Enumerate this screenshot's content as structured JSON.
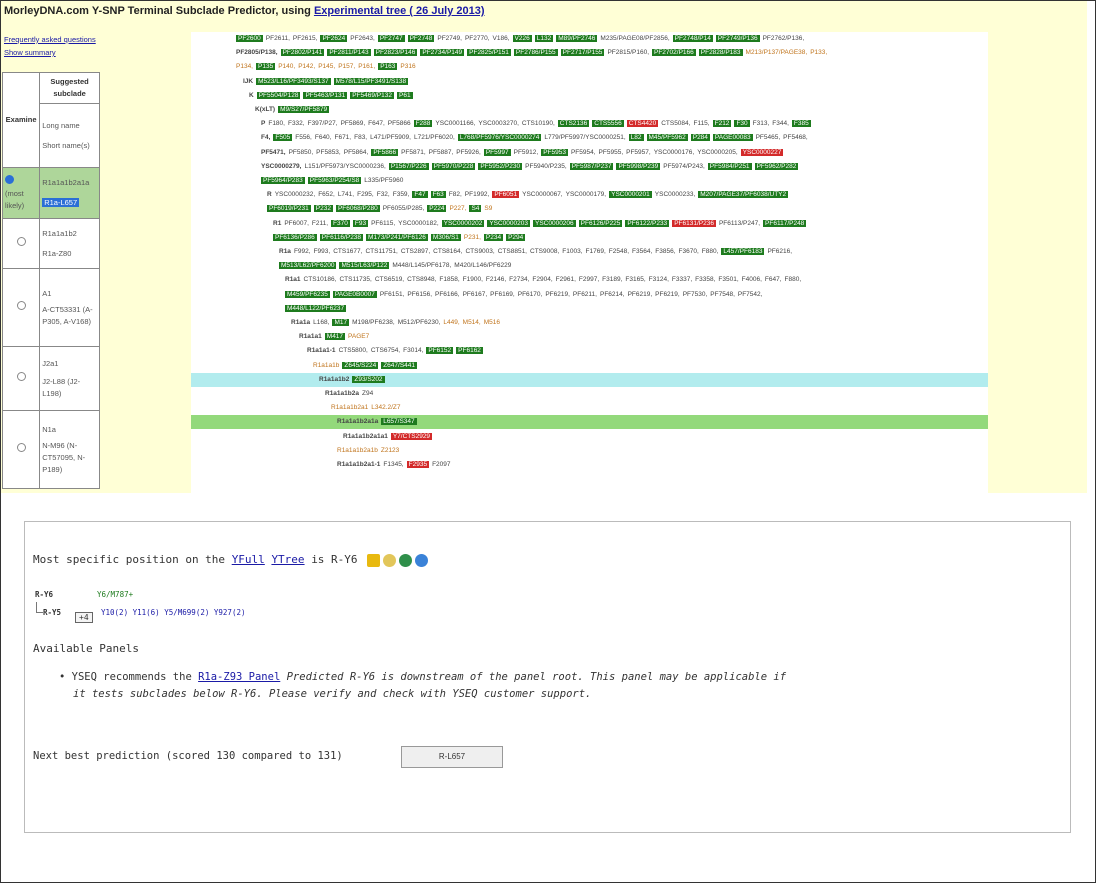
{
  "header": {
    "title": "MorleyDNA.com Y-SNP Terminal Subclade Predictor, using",
    "tree_link": "Experimental tree ( 26 July 2013)",
    "faq_link": "Frequently asked questions",
    "summary_link": "Show summary"
  },
  "sidebar": {
    "col_examine": "Examine",
    "col_suggested": "Suggested subclade",
    "col_names_long": "Long name",
    "col_names_short": "Short name(s)",
    "rows": [
      {
        "radio": "(most likely)",
        "long": "R1a1a1b2a1a",
        "short": "R1a-L657",
        "selected": true
      },
      {
        "radio": "",
        "long": "R1a1a1b2",
        "short": "R1a-Z80",
        "selected": false
      },
      {
        "radio": "",
        "long": "A1",
        "short": "A-CT53331 (A-P305, A-V168)",
        "selected": false
      },
      {
        "radio": "",
        "long": "J2a1",
        "short": "J2-L88 (J2-L198)",
        "selected": false
      },
      {
        "radio": "",
        "long": "N1a",
        "short": "N-M96 (N-CT57095, N-P189)",
        "selected": false
      }
    ]
  },
  "tree": [
    {
      "indent": 45,
      "items": [
        [
          "g",
          "PF2600"
        ],
        [
          "t",
          "PF2611,"
        ],
        [
          "t",
          "PF2615,"
        ],
        [
          "g",
          "PF2624"
        ],
        [
          "t",
          "PF2643,"
        ],
        [
          "g",
          "PF2747"
        ],
        [
          "g",
          "PF2748"
        ],
        [
          "t",
          "PF2749,"
        ],
        [
          "t",
          "PF2770,"
        ],
        [
          "t",
          "V186,"
        ],
        [
          "g",
          "V226"
        ],
        [
          "g",
          "L132"
        ],
        [
          "g",
          "M89/PF2746"
        ],
        [
          "t",
          "M235/PAGE08/PF2856,"
        ],
        [
          "g",
          "PF2748/P14"
        ],
        [
          "g",
          "PF2749/P136"
        ],
        [
          "t",
          "PF2762/P136,"
        ]
      ]
    },
    {
      "indent": 45,
      "items": [
        [
          "t",
          "PF2805/P138,"
        ],
        [
          "g",
          "PF2802/P141"
        ],
        [
          "g",
          "PF2811/P143"
        ],
        [
          "g",
          "PF2823/P146"
        ],
        [
          "g",
          "PF2734/P149"
        ],
        [
          "g",
          "PF2825/P151"
        ],
        [
          "g",
          "PF2786/P155"
        ],
        [
          "g",
          "PF2717/P155"
        ],
        [
          "t",
          "PF2815/P160,"
        ],
        [
          "g",
          "PF2702/P166"
        ],
        [
          "g",
          "PF2828/P183"
        ],
        [
          "o",
          "M213/P137/PAGE38,"
        ],
        [
          "o",
          "P133,"
        ]
      ]
    },
    {
      "indent": 45,
      "items": [
        [
          "o",
          "P134,"
        ],
        [
          "g",
          "P135"
        ],
        [
          "o",
          "P140,"
        ],
        [
          "o",
          "P142,"
        ],
        [
          "o",
          "P145,"
        ],
        [
          "o",
          "P157,"
        ],
        [
          "o",
          "P161,"
        ],
        [
          "g",
          "P163"
        ],
        [
          "o",
          "P316"
        ]
      ]
    },
    {
      "indent": 52,
      "items": [
        [
          "t",
          "IJK"
        ],
        [
          "g",
          "M523/L16/PF3493/S137"
        ],
        [
          "g",
          "M578/L15/PF3491/S138"
        ]
      ]
    },
    {
      "indent": 58,
      "items": [
        [
          "t",
          "K"
        ],
        [
          "g",
          "PF5504/P128"
        ],
        [
          "g",
          "PF5463/P131"
        ],
        [
          "g",
          "PF5469/P132"
        ],
        [
          "g",
          "P61"
        ]
      ]
    },
    {
      "indent": 64,
      "items": [
        [
          "t",
          "K(xLT)"
        ],
        [
          "g",
          "M9/S27/PF5879"
        ]
      ]
    },
    {
      "indent": 70,
      "items": [
        [
          "t",
          "P"
        ],
        [
          "t",
          "F180,"
        ],
        [
          "t",
          "F332,"
        ],
        [
          "t",
          "F397/P27,"
        ],
        [
          "t",
          "PF5869,"
        ],
        [
          "t",
          "F647,"
        ],
        [
          "t",
          "PF5866"
        ],
        [
          "g",
          "F288"
        ],
        [
          "t",
          "YSC0001166,"
        ],
        [
          "t",
          "YSC0003270,"
        ],
        [
          "t",
          "CTS10190,"
        ],
        [
          "g",
          "CTS2136"
        ],
        [
          "g",
          "CTS5556"
        ],
        [
          "r",
          "CTS4420"
        ],
        [
          "t",
          "CTS5084,"
        ],
        [
          "t",
          "F115,"
        ],
        [
          "g",
          "F212"
        ],
        [
          "g",
          "F30"
        ],
        [
          "t",
          "F313,"
        ],
        [
          "t",
          "F344,"
        ],
        [
          "g",
          "F385"
        ]
      ]
    },
    {
      "indent": 70,
      "items": [
        [
          "t",
          "F4,"
        ],
        [
          "g",
          "F505"
        ],
        [
          "t",
          "F556,"
        ],
        [
          "t",
          "F640,"
        ],
        [
          "t",
          "F671,"
        ],
        [
          "t",
          "F83,"
        ],
        [
          "t",
          "L471/PF5909,"
        ],
        [
          "t",
          "L721/PF6020,"
        ],
        [
          "g",
          "L768/PF5976/YSC0000274"
        ],
        [
          "t",
          "L779/PF5997/YSC0000251,"
        ],
        [
          "g",
          "L82"
        ],
        [
          "g",
          "M45/PF5962"
        ],
        [
          "g",
          "P284"
        ],
        [
          "g",
          "PAGE00083"
        ],
        [
          "t",
          "PF5465,"
        ],
        [
          "t",
          "PF5468,"
        ]
      ]
    },
    {
      "indent": 70,
      "items": [
        [
          "t",
          "PF5471,"
        ],
        [
          "t",
          "PF5850,"
        ],
        [
          "t",
          "PF5853,"
        ],
        [
          "t",
          "PF5864,"
        ],
        [
          "g",
          "PF5866"
        ],
        [
          "t",
          "PF5871,"
        ],
        [
          "t",
          "PF5887,"
        ],
        [
          "t",
          "PF5926,"
        ],
        [
          "g",
          "PF5997"
        ],
        [
          "t",
          "PF5912,"
        ],
        [
          "g",
          "PF5953"
        ],
        [
          "t",
          "PF5954,"
        ],
        [
          "t",
          "PF5955,"
        ],
        [
          "t",
          "PF5957,"
        ],
        [
          "t",
          "YSC0000176,"
        ],
        [
          "t",
          "YSC0000205,"
        ],
        [
          "r",
          "YSC0000227"
        ]
      ]
    },
    {
      "indent": 70,
      "items": [
        [
          "t",
          "YSC0000279,"
        ],
        [
          "t",
          "L151/PF5973/YSC0000236,"
        ],
        [
          "g",
          "P1567/P226"
        ],
        [
          "g",
          "PF5970/P228"
        ],
        [
          "g",
          "PF5952/P230"
        ],
        [
          "t",
          "PF5940/P235,"
        ],
        [
          "g",
          "PF5987/P237"
        ],
        [
          "g",
          "PF5998/P239"
        ],
        [
          "t",
          "PF5974/P243,"
        ],
        [
          "g",
          "PF5984/P251"
        ],
        [
          "g",
          "PF5962/P282"
        ]
      ]
    },
    {
      "indent": 70,
      "items": [
        [
          "g",
          "PF5964/P283"
        ],
        [
          "g",
          "PF5963/P254/S8"
        ],
        [
          "t",
          "L335/PF5960"
        ]
      ]
    },
    {
      "indent": 76,
      "items": [
        [
          "t",
          "R"
        ],
        [
          "t",
          "YSC0000232,"
        ],
        [
          "t",
          "F652,"
        ],
        [
          "t",
          "L741,"
        ],
        [
          "t",
          "F295,"
        ],
        [
          "t",
          "F32,"
        ],
        [
          "t",
          "F359,"
        ],
        [
          "g",
          "F47"
        ],
        [
          "g",
          "F63"
        ],
        [
          "t",
          "F82,"
        ],
        [
          "t",
          "PF1992,"
        ],
        [
          "r",
          "PF6051"
        ],
        [
          "t",
          "YSC0000067,"
        ],
        [
          "t",
          "YSC0000179,"
        ],
        [
          "g",
          "YSC0000201"
        ],
        [
          "t",
          "YSC0000233,"
        ],
        [
          "g",
          "M207/PAGE37/PF6038/UTY2"
        ]
      ]
    },
    {
      "indent": 76,
      "items": [
        [
          "g",
          "PF6019/P231"
        ],
        [
          "g",
          "P232"
        ],
        [
          "g",
          "PF6068/P280"
        ],
        [
          "t",
          "PF6055/P285,"
        ],
        [
          "g",
          "P224"
        ],
        [
          "o",
          "P227,"
        ],
        [
          "g",
          "S4"
        ],
        [
          "o",
          "S9"
        ]
      ]
    },
    {
      "indent": 82,
      "items": [
        [
          "t",
          "R1"
        ],
        [
          "t",
          "PF6007,"
        ],
        [
          "t",
          "F211,"
        ],
        [
          "g",
          "F370"
        ],
        [
          "g",
          "F93"
        ],
        [
          "t",
          "PF6115,"
        ],
        [
          "t",
          "YSC0000182,"
        ],
        [
          "g",
          "YSC0000202"
        ],
        [
          "g",
          "YSC0000203"
        ],
        [
          "g",
          "YSC0000206"
        ],
        [
          "g",
          "PF6126/P225"
        ],
        [
          "g",
          "PF6122/P233"
        ],
        [
          "r",
          "PF6131/P236"
        ],
        [
          "t",
          "PF6113/P247,"
        ],
        [
          "g",
          "PF6117/P248"
        ]
      ]
    },
    {
      "indent": 82,
      "items": [
        [
          "g",
          "PF6136/P286"
        ],
        [
          "g",
          "PF6116/P238"
        ],
        [
          "g",
          "M173/P241/PF6126"
        ],
        [
          "g",
          "M306/S1"
        ],
        [
          "o",
          "P231,"
        ],
        [
          "g",
          "P234"
        ],
        [
          "g",
          "P294"
        ]
      ]
    },
    {
      "indent": 88,
      "items": [
        [
          "t",
          "R1a"
        ],
        [
          "t",
          "F992,"
        ],
        [
          "t",
          "F993,"
        ],
        [
          "t",
          "CTS1677,"
        ],
        [
          "t",
          "CTS11751,"
        ],
        [
          "t",
          "CTS2897,"
        ],
        [
          "t",
          "CTS8164,"
        ],
        [
          "t",
          "CTS9003,"
        ],
        [
          "t",
          "CTS8851,"
        ],
        [
          "t",
          "CTS9008,"
        ],
        [
          "t",
          "F1003,"
        ],
        [
          "t",
          "F1769,"
        ],
        [
          "t",
          "F2548,"
        ],
        [
          "t",
          "F3564,"
        ],
        [
          "t",
          "F3856,"
        ],
        [
          "t",
          "F3670,"
        ],
        [
          "t",
          "F880,"
        ],
        [
          "g",
          "L457/PF6183"
        ],
        [
          "t",
          "PF6216,"
        ]
      ]
    },
    {
      "indent": 88,
      "items": [
        [
          "g",
          "M513/L62/PF6200"
        ],
        [
          "g",
          "M515/L63/P122"
        ],
        [
          "t",
          "M448/L145/PF6178,"
        ],
        [
          "t",
          "M420/L146/PF6229"
        ]
      ]
    },
    {
      "indent": 94,
      "items": [
        [
          "t",
          "R1a1"
        ],
        [
          "t",
          "CTS10186,"
        ],
        [
          "t",
          "CTS11735,"
        ],
        [
          "t",
          "CTS6519,"
        ],
        [
          "t",
          "CTS8948,"
        ],
        [
          "t",
          "F1858,"
        ],
        [
          "t",
          "F1900,"
        ],
        [
          "t",
          "F2146,"
        ],
        [
          "t",
          "F2734,"
        ],
        [
          "t",
          "F2904,"
        ],
        [
          "t",
          "F2961,"
        ],
        [
          "t",
          "F2997,"
        ],
        [
          "t",
          "F3189,"
        ],
        [
          "t",
          "F3165,"
        ],
        [
          "t",
          "F3124,"
        ],
        [
          "t",
          "F3337,"
        ],
        [
          "t",
          "F3358,"
        ],
        [
          "t",
          "F3501,"
        ],
        [
          "t",
          "F4006,"
        ],
        [
          "t",
          "F647,"
        ],
        [
          "t",
          "F880,"
        ]
      ]
    },
    {
      "indent": 94,
      "items": [
        [
          "g",
          "M459/PF6235"
        ],
        [
          "g",
          "PAGE0B0007"
        ],
        [
          "t",
          "PF6151,"
        ],
        [
          "t",
          "PF6156,"
        ],
        [
          "t",
          "PF6166,"
        ],
        [
          "t",
          "PF6167,"
        ],
        [
          "t",
          "PF6169,"
        ],
        [
          "t",
          "PF6170,"
        ],
        [
          "t",
          "PF6219,"
        ],
        [
          "t",
          "PF6211,"
        ],
        [
          "t",
          "PF6214,"
        ],
        [
          "t",
          "PF6219,"
        ],
        [
          "t",
          "PF6219,"
        ],
        [
          "t",
          "PF7530,"
        ],
        [
          "t",
          "PF7548,"
        ],
        [
          "t",
          "PF7542,"
        ]
      ]
    },
    {
      "indent": 94,
      "items": [
        [
          "g",
          "M448/L122/PF6237"
        ]
      ]
    },
    {
      "indent": 100,
      "items": [
        [
          "t",
          "R1a1a"
        ],
        [
          "t",
          "L168,"
        ],
        [
          "g",
          "M17"
        ],
        [
          "t",
          "M198/PF6238,"
        ],
        [
          "t",
          "M512/PF6230,"
        ],
        [
          "o",
          "L449,"
        ],
        [
          "o",
          "M514,"
        ],
        [
          "o",
          "M516"
        ]
      ]
    },
    {
      "indent": 108,
      "items": [
        [
          "t",
          "R1a1a1"
        ],
        [
          "g",
          "M417"
        ],
        [
          "o",
          "PAGE7"
        ]
      ]
    },
    {
      "indent": 116,
      "items": [
        [
          "t",
          "R1a1a1-1"
        ],
        [
          "t",
          "CTS5800,"
        ],
        [
          "t",
          "CTS6754,"
        ],
        [
          "t",
          "F3014,"
        ],
        [
          "g",
          "PF6152"
        ],
        [
          "g",
          "PF6162"
        ]
      ]
    },
    {
      "indent": 122,
      "items": [
        [
          "o",
          "R1a1a1b"
        ],
        [
          "g",
          "Z645/S224"
        ],
        [
          "g",
          "Z647/S441"
        ]
      ]
    },
    {
      "indent": 128,
      "hl": "cyan",
      "items": [
        [
          "t",
          "R1a1a1b2"
        ],
        [
          "g",
          "Z93/S202"
        ]
      ]
    },
    {
      "indent": 134,
      "items": [
        [
          "t",
          "R1a1a1b2a"
        ],
        [
          "t",
          "Z94"
        ]
      ]
    },
    {
      "indent": 140,
      "items": [
        [
          "o",
          "R1a1a1b2a1"
        ],
        [
          "o",
          "L342.2/Z7"
        ]
      ]
    },
    {
      "indent": 146,
      "hl": "green",
      "items": [
        [
          "t",
          "R1a1a1b2a1a"
        ],
        [
          "g",
          "L657/S347"
        ]
      ]
    },
    {
      "indent": 152,
      "items": [
        [
          "t",
          "R1a1a1b2a1a1"
        ],
        [
          "r",
          "Y7/CTS2929"
        ]
      ]
    },
    {
      "indent": 146,
      "items": [
        [
          "o",
          "R1a1a1b2a1b"
        ],
        [
          "o",
          "Z2123"
        ]
      ]
    },
    {
      "indent": 146,
      "items": [
        [
          "t",
          "R1a1a1b2a1-1"
        ],
        [
          "t",
          "F1345,"
        ],
        [
          "r",
          "F2935"
        ],
        [
          "t",
          "F2097"
        ]
      ]
    }
  ],
  "bottom": {
    "heading_pre": "Most specific position on the",
    "yfull": "YFull",
    "ytree": "YTree",
    "heading_post": "is R-Y6",
    "y6_name": "R-Y6",
    "y6_snps": "Y6/M787+",
    "y5_name": "R-Y5",
    "plus": "+4",
    "y5_children": "Y10(2) Y11(6) Y5/M699(2) Y927(2)",
    "panels_heading": "Available Panels",
    "rec_pre": "YSEQ recommends the",
    "rec_link": "R1a-Z93 Panel",
    "rec_text_1": "Predicted R-Y6 is downstream of the panel root. This panel may be applicable if",
    "rec_text_2": "it tests subclades below R-Y6. Please verify and check with YSEQ customer support.",
    "next_best": "Next best prediction (scored 130 compared to 131)",
    "next_button": "R-L657"
  },
  "colors": {
    "snp_green": "#1e7b1e",
    "snp_red": "#d32a2a",
    "row_cyan": "#b2ecee",
    "row_green": "#93d97b",
    "top_bg": "#ffffd6"
  }
}
